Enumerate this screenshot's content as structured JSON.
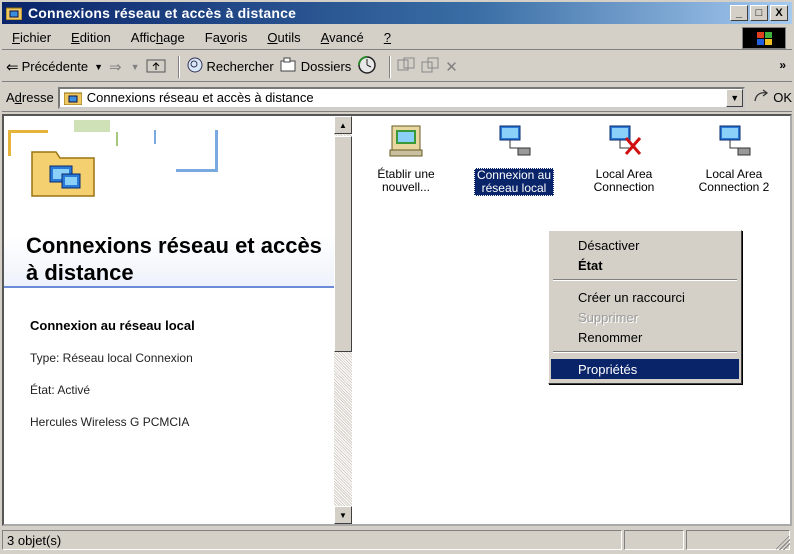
{
  "window": {
    "title": "Connexions réseau et accès à distance",
    "controls": {
      "minimize": "_",
      "maximize": "□",
      "close": "X"
    }
  },
  "menubar": {
    "items": [
      {
        "pre": "",
        "key": "F",
        "post": "ichier"
      },
      {
        "pre": "",
        "key": "E",
        "post": "dition"
      },
      {
        "pre": "Affic",
        "key": "h",
        "post": "age"
      },
      {
        "pre": "Fa",
        "key": "v",
        "post": "oris"
      },
      {
        "pre": "",
        "key": "O",
        "post": "utils"
      },
      {
        "pre": "",
        "key": "A",
        "post": "vancé"
      },
      {
        "pre": "",
        "key": "?",
        "post": ""
      }
    ]
  },
  "toolbar": {
    "back_label": "Précédente",
    "search_label": "Rechercher",
    "folders_label": "Dossiers",
    "overflow": "»"
  },
  "address": {
    "label_pre": "A",
    "label_key": "d",
    "label_post": "resse",
    "value": "Connexions réseau et accès à distance",
    "go_label": "OK"
  },
  "leftpane": {
    "title": "Connexions réseau et accès à distance",
    "selected_name": "Connexion au réseau local",
    "type": "Type: Réseau local Connexion",
    "state": "État: Activé",
    "device": "Hercules Wireless G PCMCIA"
  },
  "icons": [
    {
      "line1": "Établir une",
      "line2": "nouvell...",
      "kind": "wizard"
    },
    {
      "line1": "Connexion au",
      "line2": "réseau local",
      "kind": "network",
      "selected": true
    },
    {
      "line1": "Local Area",
      "line2": "Connection",
      "kind": "network-disabled"
    },
    {
      "line1": "Local Area",
      "line2": "Connection 2",
      "kind": "network"
    }
  ],
  "context_menu": {
    "items": [
      {
        "label": "Désactiver",
        "style": "normal"
      },
      {
        "label": "État",
        "style": "bold"
      },
      {
        "label": "Créer un raccourci",
        "style": "normal"
      },
      {
        "label": "Supprimer",
        "style": "disabled"
      },
      {
        "label": "Renommer",
        "style": "normal"
      },
      {
        "label": "Propriétés",
        "style": "active"
      }
    ]
  },
  "statusbar": {
    "count": "3 objet(s)"
  },
  "colors": {
    "title_bar": "#0a246a",
    "selection": "#0a246a",
    "chrome": "#d4d0c8"
  }
}
